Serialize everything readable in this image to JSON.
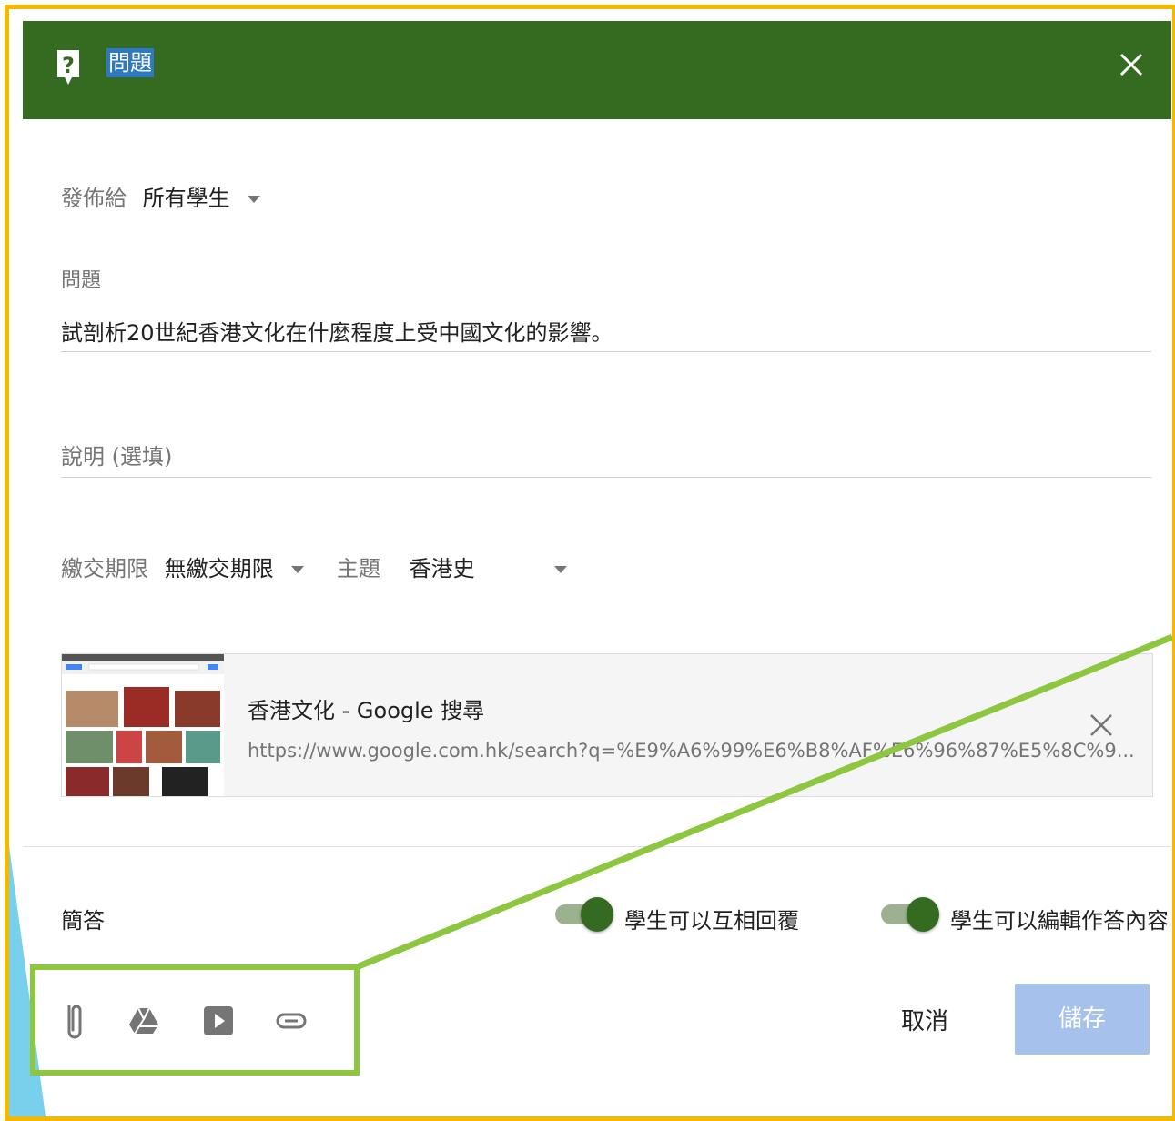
{
  "header": {
    "title": "問題"
  },
  "assign": {
    "label": "發佈給",
    "value": "所有學生"
  },
  "question": {
    "label": "問題",
    "value": "試剖析20世紀香港文化在什麼程度上受中國文化的影響。"
  },
  "description": {
    "placeholder": "說明 (選填)"
  },
  "due": {
    "label": "繳交期限",
    "value": "無繳交期限"
  },
  "topic": {
    "label": "主題",
    "value": "香港史"
  },
  "attachment": {
    "title": "香港文化 - Google 搜尋",
    "url": "https://www.google.com.hk/search?q=%E9%A6%99%E6%B8%AF%E6%96%87%E5%8C%9..."
  },
  "answer_type": "簡答",
  "toggles": [
    {
      "label": "學生可以互相回覆",
      "on": true
    },
    {
      "label": "學生可以編輯作答內容",
      "on": true
    }
  ],
  "footer": {
    "tools": [
      "paperclip-icon",
      "drive-icon",
      "youtube-icon",
      "link-icon"
    ],
    "cancel": "取消",
    "save": "儲存"
  },
  "colors": {
    "header": "#356b20",
    "frame": "#f5b800",
    "highlight": "#8dc63f",
    "save": "#a6c2ec"
  }
}
